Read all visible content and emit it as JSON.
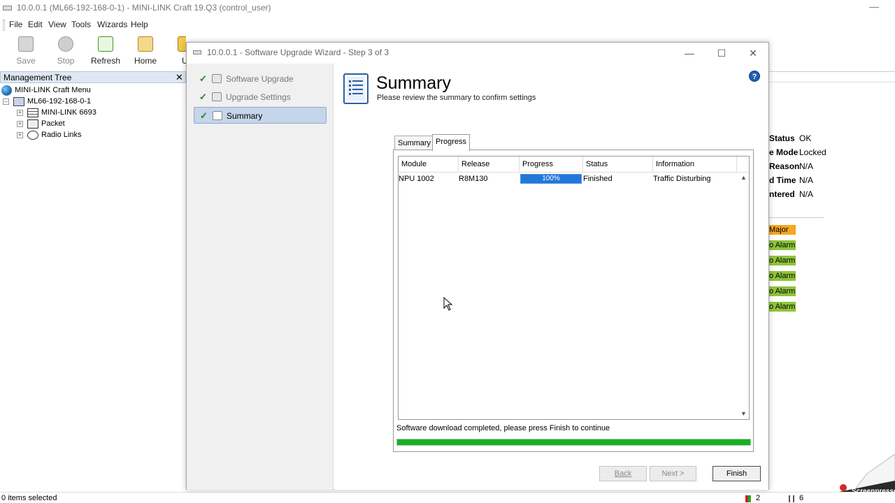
{
  "window": {
    "title": "10.0.0.1 (ML66-192-168-0-1) - MINI-LINK Craft 19.Q3 (control_user)"
  },
  "menu": [
    "File",
    "Edit",
    "View",
    "Tools",
    "Wizards",
    "Help"
  ],
  "toolbar": {
    "save": "Save",
    "stop": "Stop",
    "refresh": "Refresh",
    "home": "Home",
    "upgrade": "U"
  },
  "tree": {
    "header": "Management Tree",
    "items": [
      "MINI-LINK Craft Menu",
      "ML66-192-168-0-1",
      "MINI-LINK 6693",
      "Packet",
      "Radio Links"
    ]
  },
  "properties": [
    {
      "label": "Status",
      "value": "OK"
    },
    {
      "label": "e Mode",
      "value": "Locked"
    },
    {
      "label": "Reason",
      "value": "N/A"
    },
    {
      "label": "d Time",
      "value": "N/A"
    },
    {
      "label": "ntered",
      "value": "N/A"
    }
  ],
  "alarms": [
    {
      "text": "Major",
      "color": "#f5a623"
    },
    {
      "text": "o Alarm",
      "color": "#8fc43a"
    },
    {
      "text": "o Alarm",
      "color": "#8fc43a"
    },
    {
      "text": "o Alarm",
      "color": "#8fc43a"
    },
    {
      "text": "o Alarm",
      "color": "#8fc43a"
    },
    {
      "text": "o Alarm",
      "color": "#8fc43a"
    }
  ],
  "statusbar": {
    "selection": "0 items selected",
    "count1": "2",
    "count2": "6"
  },
  "dialog": {
    "title": "10.0.0.1 - Software Upgrade Wizard - Step 3 of 3",
    "steps": [
      "Software Upgrade",
      "Upgrade Settings",
      "Summary"
    ],
    "heading": "Summary",
    "subheading": "Please review the summary to confirm settings",
    "tabs": [
      "Summary",
      "Progress"
    ],
    "columns": [
      "Module",
      "Release",
      "Progress",
      "Status",
      "Information"
    ],
    "rows": [
      {
        "module": "NPU 1002",
        "release": "R8M130",
        "progress": 100,
        "progress_label": "100%",
        "status": "Finished",
        "information": "Traffic Disturbing"
      }
    ],
    "message": "Software download completed, please press Finish to continue",
    "overall_progress": 1.0,
    "buttons": {
      "back": "Back",
      "next": "Next >",
      "finish": "Finish"
    }
  },
  "watermark": "Screenpresso",
  "colors": {
    "accent": "#2277dd",
    "progress_green": "#13b320",
    "selection": "#c5d5ea"
  }
}
